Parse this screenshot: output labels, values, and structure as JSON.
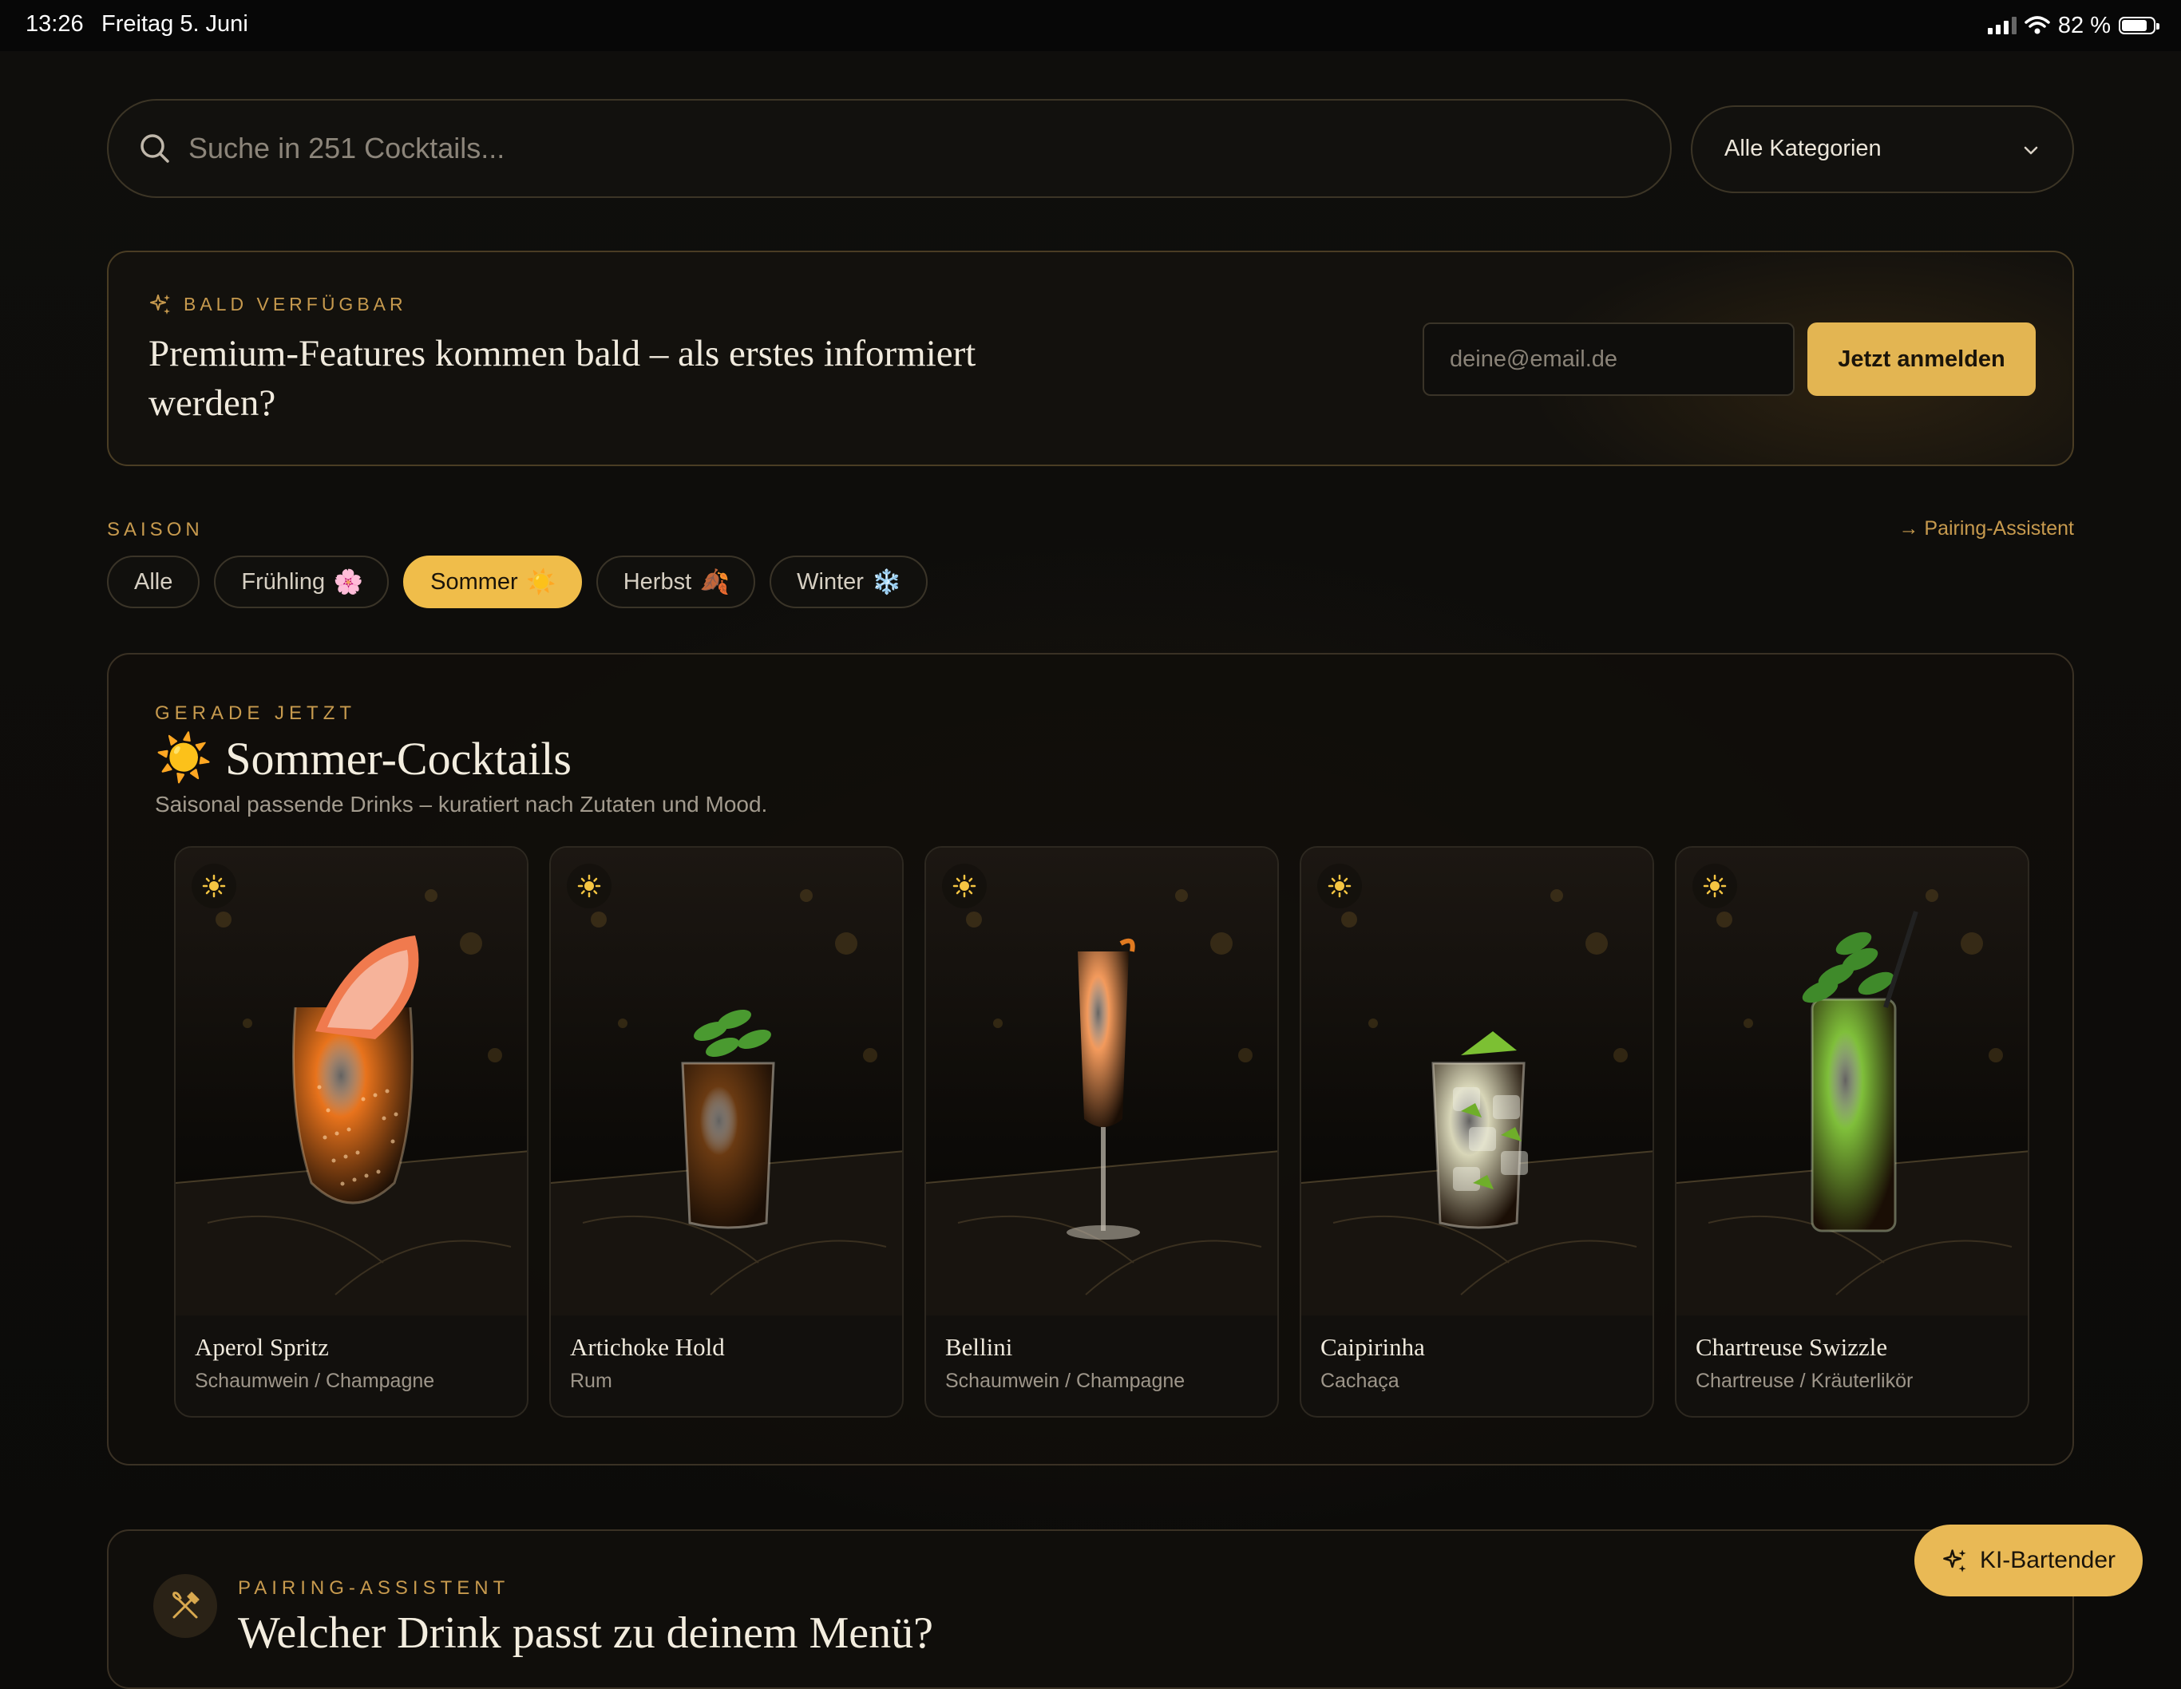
{
  "status_bar": {
    "time": "13:26",
    "date": "Freitag 5. Juni",
    "battery": "82 %",
    "battery_level": 0.82
  },
  "search": {
    "placeholder": "Suche in 251 Cocktails..."
  },
  "category_select": {
    "selected": "Alle Kategorien"
  },
  "premium_banner": {
    "eyebrow": "BALD VERFÜGBAR",
    "title": "Premium-Features kommen bald – als erstes informiert werden?",
    "email_placeholder": "deine@email.de",
    "cta_label": "Jetzt anmelden"
  },
  "season": {
    "label": "SAISON",
    "pairing_link": "→ Pairing-Assistent",
    "chips": [
      {
        "label": "Alle",
        "emoji": "",
        "active": false
      },
      {
        "label": "Frühling",
        "emoji": "🌸",
        "active": false
      },
      {
        "label": "Sommer",
        "emoji": "☀️",
        "active": true
      },
      {
        "label": "Herbst",
        "emoji": "🍂",
        "active": false
      },
      {
        "label": "Winter",
        "emoji": "❄️",
        "active": false
      }
    ]
  },
  "summer_panel": {
    "eyebrow": "GERADE JETZT",
    "title": "Sommer-Cocktails",
    "title_emoji": "☀️",
    "subtitle": "Saisonal passende Drinks – kuratiert nach Zutaten und Mood.",
    "cards": [
      {
        "name": "Aperol Spritz",
        "category": "Schaumwein / Champagne",
        "drink_color": "#e8731c",
        "glass": "tumbler-wine"
      },
      {
        "name": "Artichoke Hold",
        "category": "Rum",
        "drink_color": "#6a3a12",
        "glass": "rocks"
      },
      {
        "name": "Bellini",
        "category": "Schaumwein / Champagne",
        "drink_color": "#f39a5c",
        "glass": "flute"
      },
      {
        "name": "Caipirinha",
        "category": "Cachaça",
        "drink_color": "#d8d6b8",
        "glass": "rocks-ice"
      },
      {
        "name": "Chartreuse Swizzle",
        "category": "Chartreuse / Kräuterlikör",
        "drink_color": "#7fbf3a",
        "glass": "highball"
      }
    ]
  },
  "pairing_section": {
    "eyebrow": "PAIRING-ASSISTENT",
    "title": "Welcher Drink passt zu deinem Menü?"
  },
  "fab": {
    "label": "KI-Bartender"
  },
  "colors": {
    "accent": "#e3b552",
    "background": "#0c0b09",
    "eyebrow": "#c79a4e"
  }
}
